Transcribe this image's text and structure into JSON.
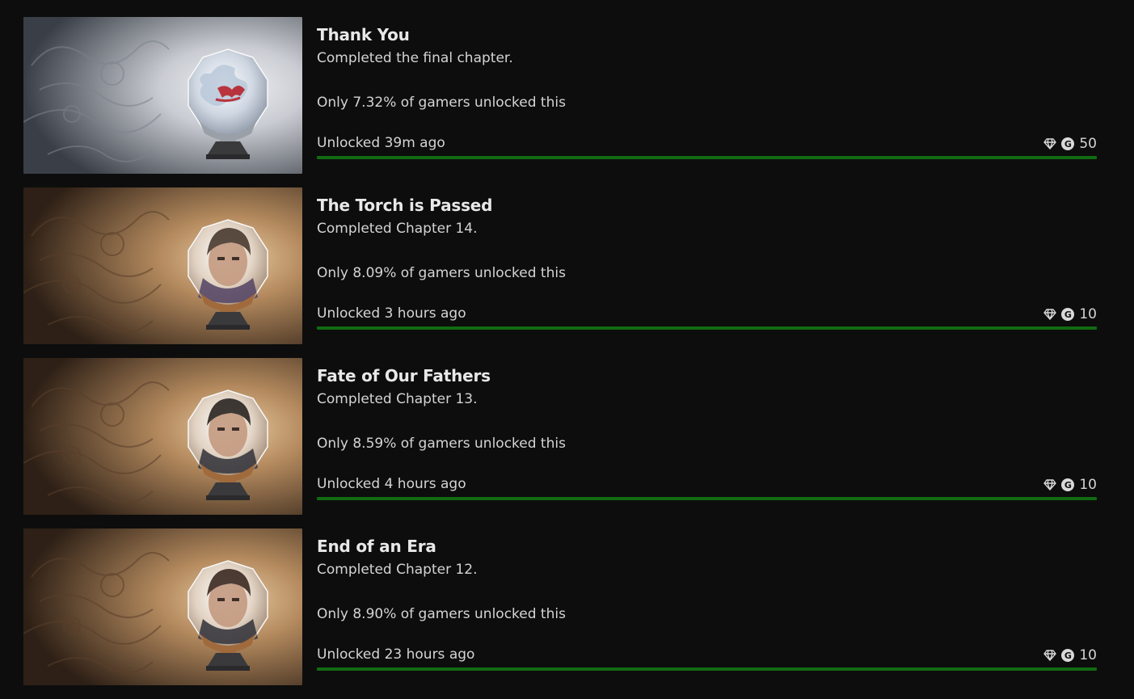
{
  "achievements": [
    {
      "title": "Thank You",
      "description": "Completed the final chapter.",
      "rarity": "Only 7.32% of gamers unlocked this",
      "unlocked": "Unlocked 39m ago",
      "gamerscore": "50",
      "progress": 1.0,
      "theme": "silver",
      "emblem": "dragon-crystal-icon"
    },
    {
      "title": "The Torch is Passed",
      "description": "Completed Chapter 14.",
      "rarity": "Only 8.09% of gamers unlocked this",
      "unlocked": "Unlocked 3 hours ago",
      "gamerscore": "10",
      "progress": 1.0,
      "theme": "bronze",
      "emblem": "portrait-crystal-icon"
    },
    {
      "title": "Fate of Our Fathers",
      "description": "Completed Chapter 13.",
      "rarity": "Only 8.59% of gamers unlocked this",
      "unlocked": "Unlocked 4 hours ago",
      "gamerscore": "10",
      "progress": 1.0,
      "theme": "bronze",
      "emblem": "portrait-crystal-icon"
    },
    {
      "title": "End of an Era",
      "description": "Completed Chapter 12.",
      "rarity": "Only 8.90% of gamers unlocked this",
      "unlocked": "Unlocked 23 hours ago",
      "gamerscore": "10",
      "progress": 1.0,
      "theme": "bronze",
      "emblem": "portrait-crystal-icon"
    }
  ],
  "icons": {
    "rarity": "diamond-icon",
    "gamerscore": "gamerscore-g-icon",
    "gamerscore_glyph": "G"
  },
  "colors": {
    "background": "#0d0d0d",
    "progress_track": "#0f4a0f",
    "progress_fill": "#116b11",
    "text_primary": "#e8e8e8",
    "text_secondary": "#d4d4d4"
  }
}
